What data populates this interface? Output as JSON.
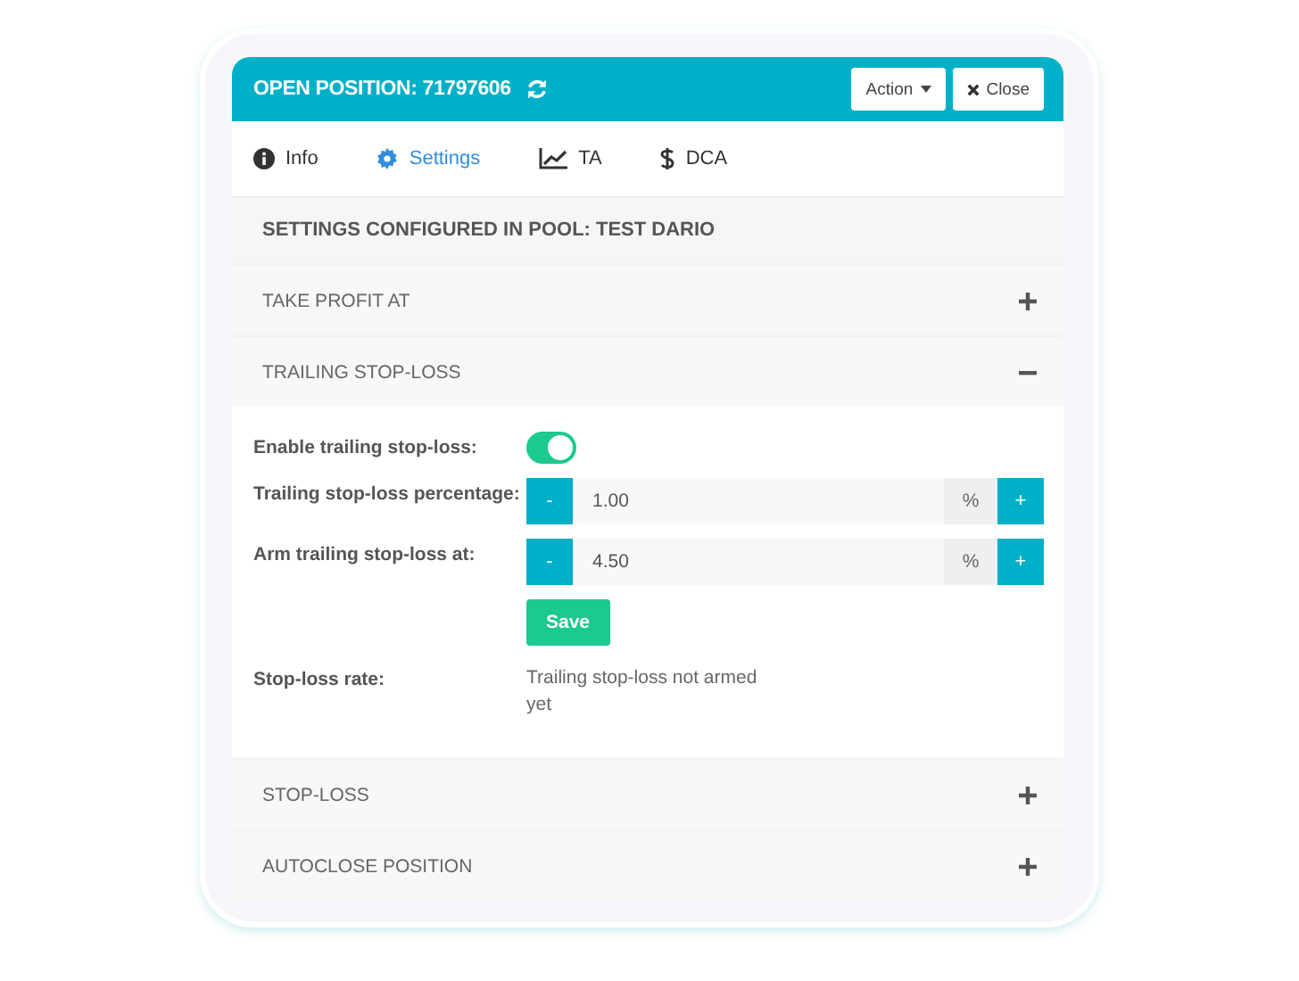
{
  "header": {
    "title": "OPEN POSITION: 71797606",
    "buttons": [
      {
        "label": "Action",
        "kind": "dropdown"
      },
      {
        "label": "Close",
        "kind": "close"
      }
    ]
  },
  "tabs": [
    {
      "label": "Info",
      "kind": "info",
      "selected": false
    },
    {
      "label": "Settings",
      "kind": "gear",
      "selected": true
    },
    {
      "label": "TA",
      "kind": "chart",
      "selected": false
    },
    {
      "label": "DCA",
      "kind": "dollar",
      "selected": false
    }
  ],
  "pool_title": "SETTINGS CONFIGURED IN POOL: TEST DARIO",
  "sections": [
    {
      "title": "TAKE PROFIT AT",
      "expanded": false
    },
    {
      "title": "TRAILING STOP-LOSS",
      "expanded": true,
      "fields": [
        {
          "kind": "toggle",
          "label": "Enable trailing stop-loss:",
          "on": true
        },
        {
          "kind": "stepper",
          "label": "Trailing stop-loss percentage:",
          "minus": "-",
          "value": "1.00",
          "unit": "%",
          "plus": "+"
        },
        {
          "kind": "stepper",
          "label": "Arm trailing stop-loss at:",
          "minus": "-",
          "value": "4.50",
          "unit": "%",
          "plus": "+"
        },
        {
          "kind": "button",
          "label": "Save"
        },
        {
          "kind": "text",
          "label": "Stop-loss rate:",
          "value": "Trailing stop-loss not armed yet"
        }
      ]
    },
    {
      "title": "STOP-LOSS",
      "expanded": false
    },
    {
      "title": "AUTOCLOSE POSITION",
      "expanded": false
    }
  ]
}
